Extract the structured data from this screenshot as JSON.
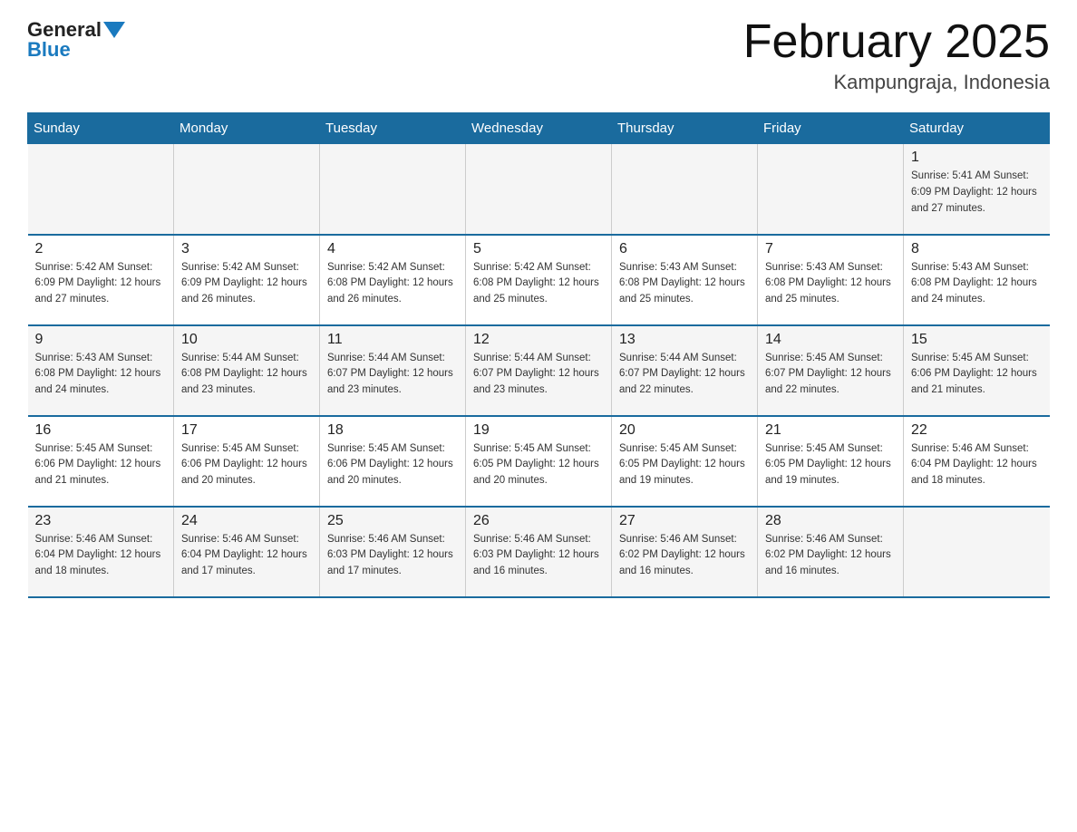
{
  "header": {
    "logo_general": "General",
    "logo_blue": "Blue",
    "month_title": "February 2025",
    "location": "Kampungraja, Indonesia"
  },
  "days_of_week": [
    "Sunday",
    "Monday",
    "Tuesday",
    "Wednesday",
    "Thursday",
    "Friday",
    "Saturday"
  ],
  "weeks": [
    [
      {
        "day": "",
        "info": ""
      },
      {
        "day": "",
        "info": ""
      },
      {
        "day": "",
        "info": ""
      },
      {
        "day": "",
        "info": ""
      },
      {
        "day": "",
        "info": ""
      },
      {
        "day": "",
        "info": ""
      },
      {
        "day": "1",
        "info": "Sunrise: 5:41 AM\nSunset: 6:09 PM\nDaylight: 12 hours\nand 27 minutes."
      }
    ],
    [
      {
        "day": "2",
        "info": "Sunrise: 5:42 AM\nSunset: 6:09 PM\nDaylight: 12 hours\nand 27 minutes."
      },
      {
        "day": "3",
        "info": "Sunrise: 5:42 AM\nSunset: 6:09 PM\nDaylight: 12 hours\nand 26 minutes."
      },
      {
        "day": "4",
        "info": "Sunrise: 5:42 AM\nSunset: 6:08 PM\nDaylight: 12 hours\nand 26 minutes."
      },
      {
        "day": "5",
        "info": "Sunrise: 5:42 AM\nSunset: 6:08 PM\nDaylight: 12 hours\nand 25 minutes."
      },
      {
        "day": "6",
        "info": "Sunrise: 5:43 AM\nSunset: 6:08 PM\nDaylight: 12 hours\nand 25 minutes."
      },
      {
        "day": "7",
        "info": "Sunrise: 5:43 AM\nSunset: 6:08 PM\nDaylight: 12 hours\nand 25 minutes."
      },
      {
        "day": "8",
        "info": "Sunrise: 5:43 AM\nSunset: 6:08 PM\nDaylight: 12 hours\nand 24 minutes."
      }
    ],
    [
      {
        "day": "9",
        "info": "Sunrise: 5:43 AM\nSunset: 6:08 PM\nDaylight: 12 hours\nand 24 minutes."
      },
      {
        "day": "10",
        "info": "Sunrise: 5:44 AM\nSunset: 6:08 PM\nDaylight: 12 hours\nand 23 minutes."
      },
      {
        "day": "11",
        "info": "Sunrise: 5:44 AM\nSunset: 6:07 PM\nDaylight: 12 hours\nand 23 minutes."
      },
      {
        "day": "12",
        "info": "Sunrise: 5:44 AM\nSunset: 6:07 PM\nDaylight: 12 hours\nand 23 minutes."
      },
      {
        "day": "13",
        "info": "Sunrise: 5:44 AM\nSunset: 6:07 PM\nDaylight: 12 hours\nand 22 minutes."
      },
      {
        "day": "14",
        "info": "Sunrise: 5:45 AM\nSunset: 6:07 PM\nDaylight: 12 hours\nand 22 minutes."
      },
      {
        "day": "15",
        "info": "Sunrise: 5:45 AM\nSunset: 6:06 PM\nDaylight: 12 hours\nand 21 minutes."
      }
    ],
    [
      {
        "day": "16",
        "info": "Sunrise: 5:45 AM\nSunset: 6:06 PM\nDaylight: 12 hours\nand 21 minutes."
      },
      {
        "day": "17",
        "info": "Sunrise: 5:45 AM\nSunset: 6:06 PM\nDaylight: 12 hours\nand 20 minutes."
      },
      {
        "day": "18",
        "info": "Sunrise: 5:45 AM\nSunset: 6:06 PM\nDaylight: 12 hours\nand 20 minutes."
      },
      {
        "day": "19",
        "info": "Sunrise: 5:45 AM\nSunset: 6:05 PM\nDaylight: 12 hours\nand 20 minutes."
      },
      {
        "day": "20",
        "info": "Sunrise: 5:45 AM\nSunset: 6:05 PM\nDaylight: 12 hours\nand 19 minutes."
      },
      {
        "day": "21",
        "info": "Sunrise: 5:45 AM\nSunset: 6:05 PM\nDaylight: 12 hours\nand 19 minutes."
      },
      {
        "day": "22",
        "info": "Sunrise: 5:46 AM\nSunset: 6:04 PM\nDaylight: 12 hours\nand 18 minutes."
      }
    ],
    [
      {
        "day": "23",
        "info": "Sunrise: 5:46 AM\nSunset: 6:04 PM\nDaylight: 12 hours\nand 18 minutes."
      },
      {
        "day": "24",
        "info": "Sunrise: 5:46 AM\nSunset: 6:04 PM\nDaylight: 12 hours\nand 17 minutes."
      },
      {
        "day": "25",
        "info": "Sunrise: 5:46 AM\nSunset: 6:03 PM\nDaylight: 12 hours\nand 17 minutes."
      },
      {
        "day": "26",
        "info": "Sunrise: 5:46 AM\nSunset: 6:03 PM\nDaylight: 12 hours\nand 16 minutes."
      },
      {
        "day": "27",
        "info": "Sunrise: 5:46 AM\nSunset: 6:02 PM\nDaylight: 12 hours\nand 16 minutes."
      },
      {
        "day": "28",
        "info": "Sunrise: 5:46 AM\nSunset: 6:02 PM\nDaylight: 12 hours\nand 16 minutes."
      },
      {
        "day": "",
        "info": ""
      }
    ]
  ]
}
